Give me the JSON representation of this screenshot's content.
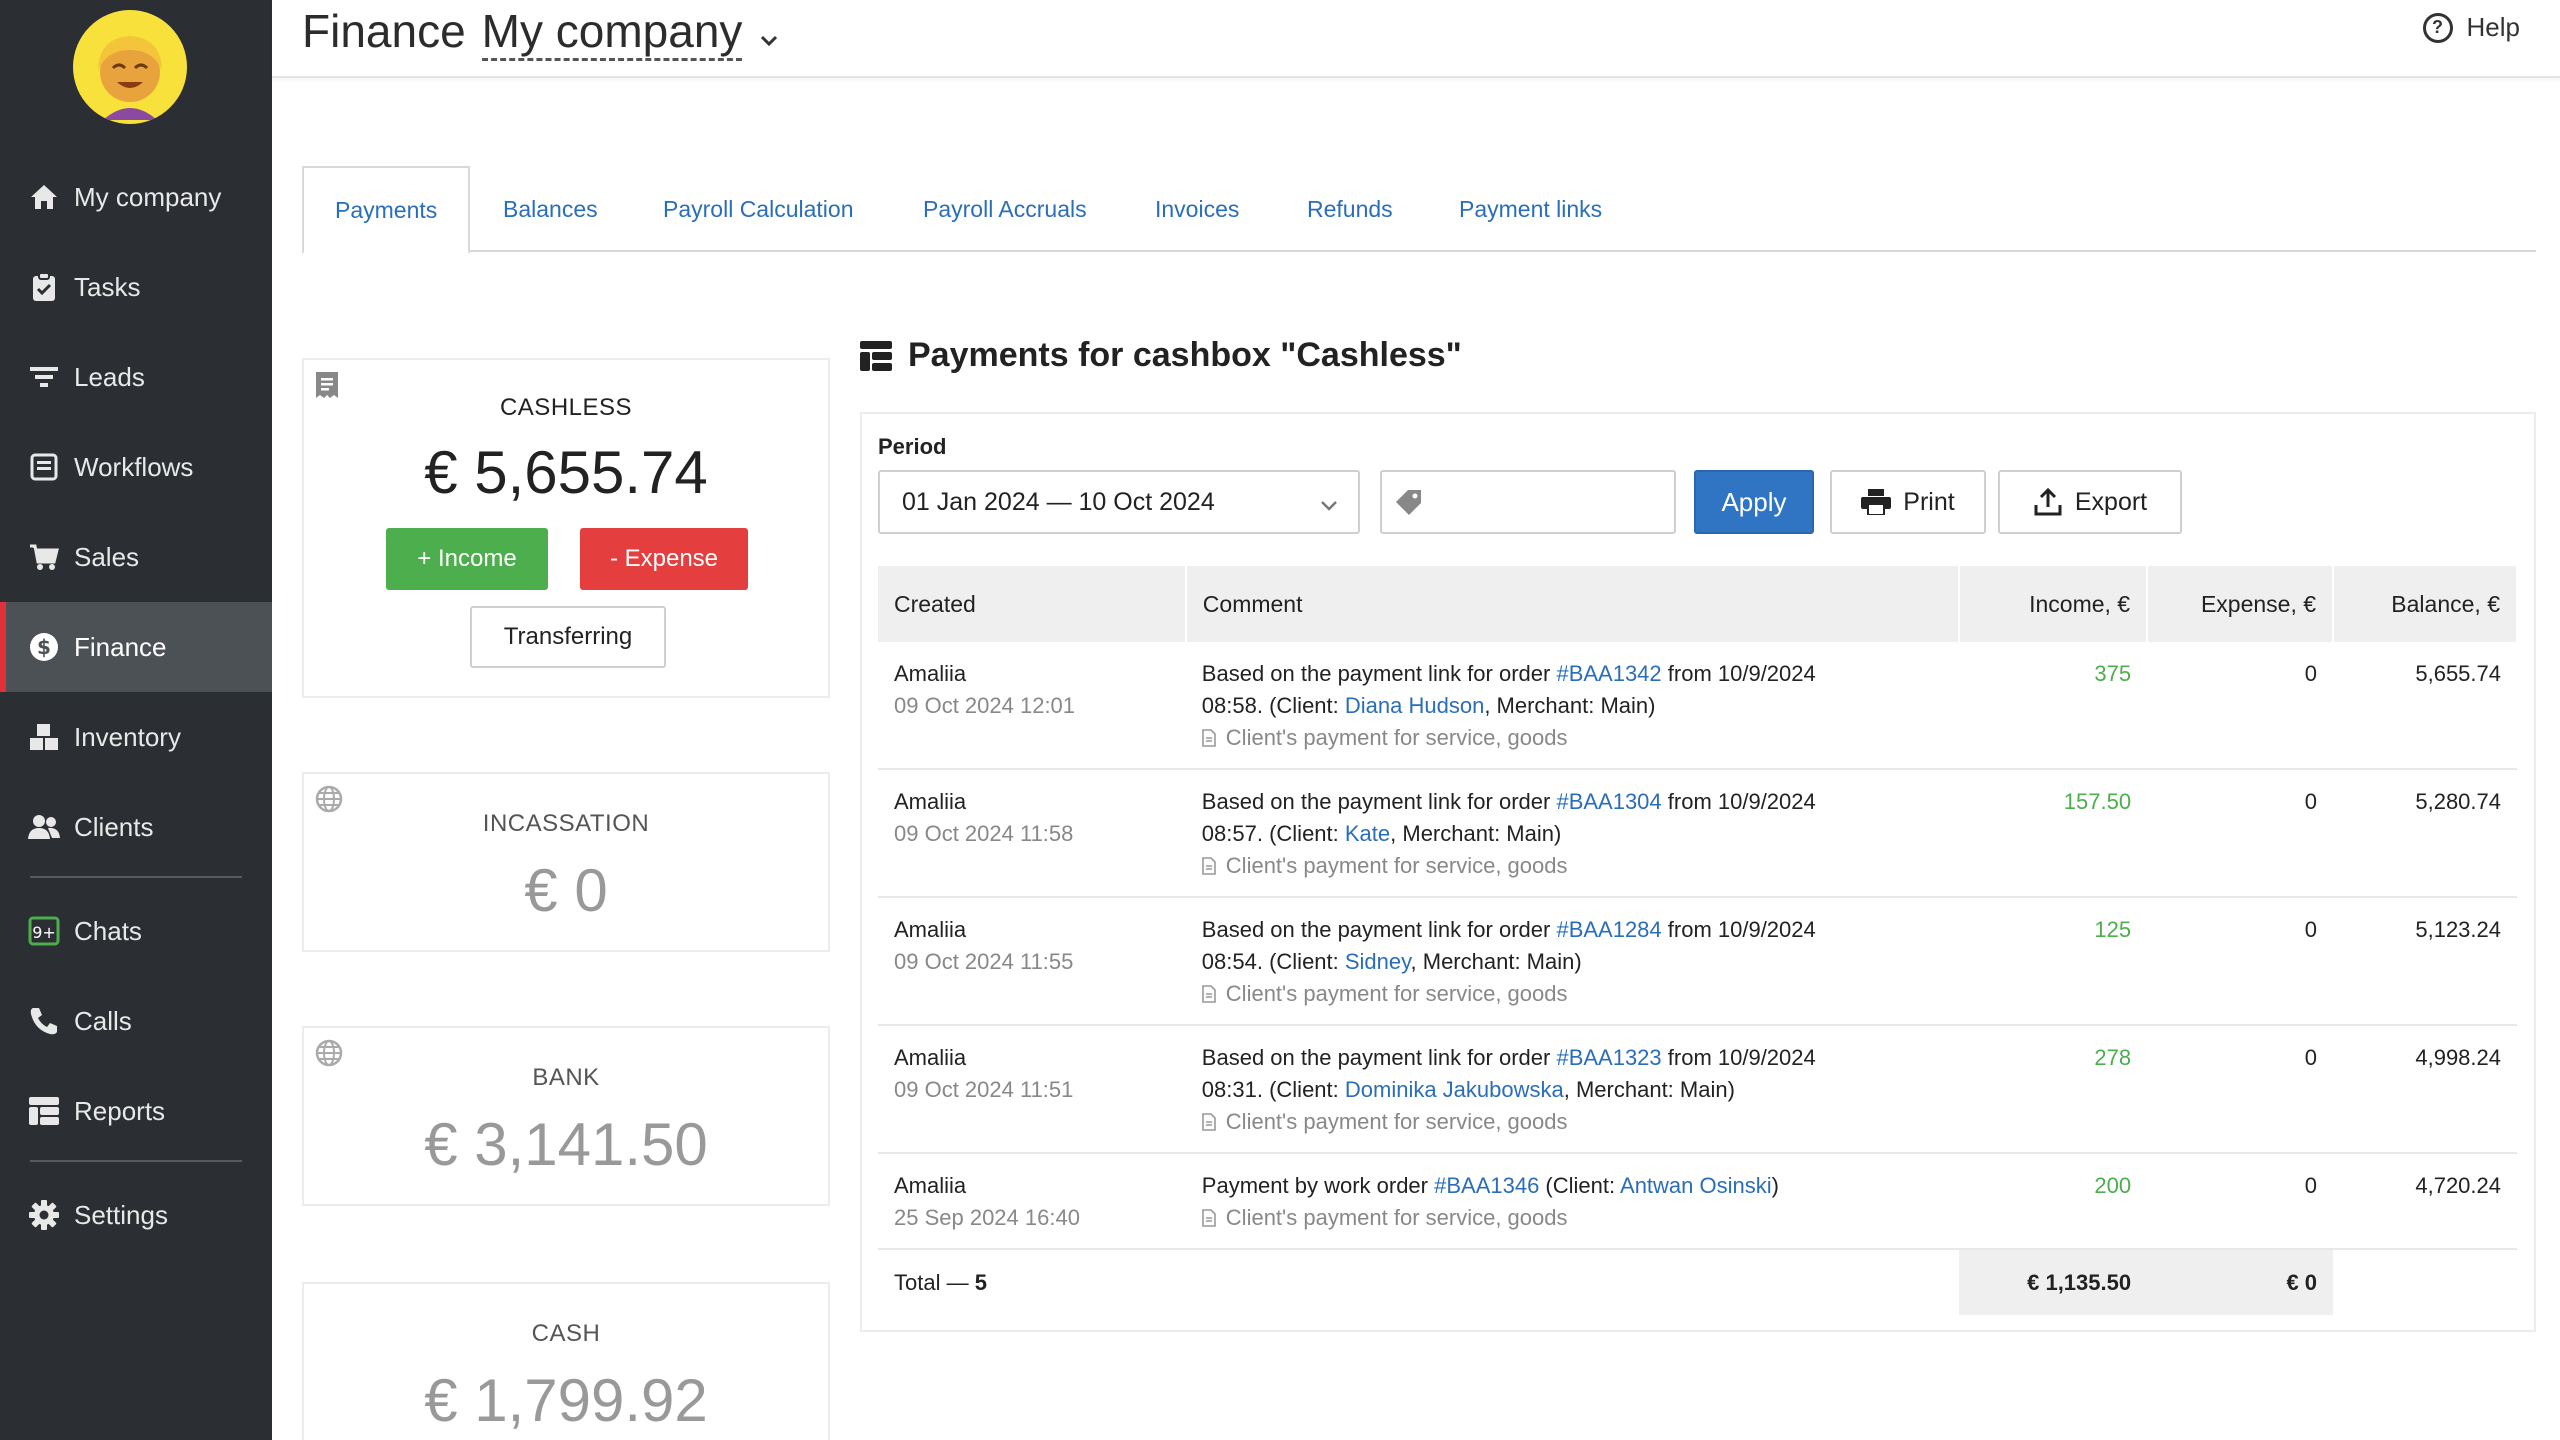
{
  "header": {
    "section": "Finance",
    "company": "My company",
    "help": "Help"
  },
  "sidebar": {
    "items": [
      {
        "label": "My company",
        "icon": "home-icon"
      },
      {
        "label": "Tasks",
        "icon": "clipboard-icon"
      },
      {
        "label": "Leads",
        "icon": "filter-icon"
      },
      {
        "label": "Workflows",
        "icon": "workflow-icon"
      },
      {
        "label": "Sales",
        "icon": "cart-icon"
      },
      {
        "label": "Finance",
        "icon": "dollar-icon"
      },
      {
        "label": "Inventory",
        "icon": "boxes-icon"
      },
      {
        "label": "Clients",
        "icon": "users-icon"
      },
      {
        "label": "Chats",
        "icon": "chat-badge-icon",
        "badge": "9+"
      },
      {
        "label": "Calls",
        "icon": "phone-icon"
      },
      {
        "label": "Reports",
        "icon": "reports-icon"
      },
      {
        "label": "Settings",
        "icon": "gear-icon"
      }
    ]
  },
  "tabs": [
    "Payments",
    "Balances",
    "Payroll Calculation",
    "Payroll Accruals",
    "Invoices",
    "Refunds",
    "Payment links"
  ],
  "cashboxes": [
    {
      "title": "CASHLESS",
      "amount": "€ 5,655.74"
    },
    {
      "title": "INCASSATION",
      "amount": "€ 0"
    },
    {
      "title": "BANK",
      "amount": "€ 3,141.50"
    },
    {
      "title": "CASH",
      "amount": "€ 1,799.92"
    }
  ],
  "cashbox_actions": {
    "income": "+ Income",
    "expense": "- Expense",
    "transfer": "Transferring"
  },
  "main": {
    "title": "Payments for cashbox \"Cashless\"",
    "period_label": "Period",
    "period_value": "01 Jan 2024 — 10 Oct 2024",
    "apply": "Apply",
    "print": "Print",
    "export": "Export"
  },
  "table": {
    "headers": [
      "Created",
      "Comment",
      "Income, €",
      "Expense, €",
      "Balance, €"
    ],
    "rows": [
      {
        "user": "Amaliia",
        "date": "09 Oct 2024 12:01",
        "c1": "Based on the payment link for order ",
        "order": "#BAA1342",
        "c2": " from 10/9/2024",
        "c3": "08:58.  (Client: ",
        "client": "Diana Hudson",
        "c4": ", Merchant: Main)",
        "note": "Client's payment for service, goods",
        "income": "375",
        "expense": "0",
        "balance": "5,655.74"
      },
      {
        "user": "Amaliia",
        "date": "09 Oct 2024 11:58",
        "c1": "Based on the payment link for order ",
        "order": "#BAA1304",
        "c2": " from 10/9/2024",
        "c3": "08:57.  (Client: ",
        "client": "Kate",
        "c4": ", Merchant: Main)",
        "note": "Client's payment for service, goods",
        "income": "157.50",
        "expense": "0",
        "balance": "5,280.74"
      },
      {
        "user": "Amaliia",
        "date": "09 Oct 2024 11:55",
        "c1": "Based on the payment link for order ",
        "order": "#BAA1284",
        "c2": " from 10/9/2024",
        "c3": "08:54.  (Client: ",
        "client": "Sidney",
        "c4": ", Merchant: Main)",
        "note": "Client's payment for service, goods",
        "income": "125",
        "expense": "0",
        "balance": "5,123.24"
      },
      {
        "user": "Amaliia",
        "date": "09 Oct 2024 11:51",
        "c1": "Based on the payment link for order ",
        "order": "#BAA1323",
        "c2": " from 10/9/2024",
        "c3": "08:31.  (Client: ",
        "client": "Dominika Jakubowska",
        "c4": ", Merchant: Main)",
        "note": "Client's payment for service, goods",
        "income": "278",
        "expense": "0",
        "balance": "4,998.24"
      }
    ],
    "row5": {
      "user": "Amaliia",
      "date": "25 Sep 2024 16:40",
      "c1": "Payment by work order ",
      "order": "#BAA1346",
      "c2": " (Client: ",
      "client": "Antwan Osinski",
      "c3": ")",
      "note": "Client's payment for service, goods",
      "income": "200",
      "expense": "0",
      "balance": "4,720.24"
    },
    "total_label": "Total — ",
    "total_count": "5",
    "total_income": "€ 1,135.50",
    "total_expense": "€ 0"
  },
  "colors": {
    "sidebar_bg": "#2b2f33",
    "active_marker": "#e0313b",
    "link": "#2a6ebb",
    "income_green": "#4cae4c",
    "expense_red": "#e53e3e",
    "apply_blue": "#2f75c4"
  }
}
